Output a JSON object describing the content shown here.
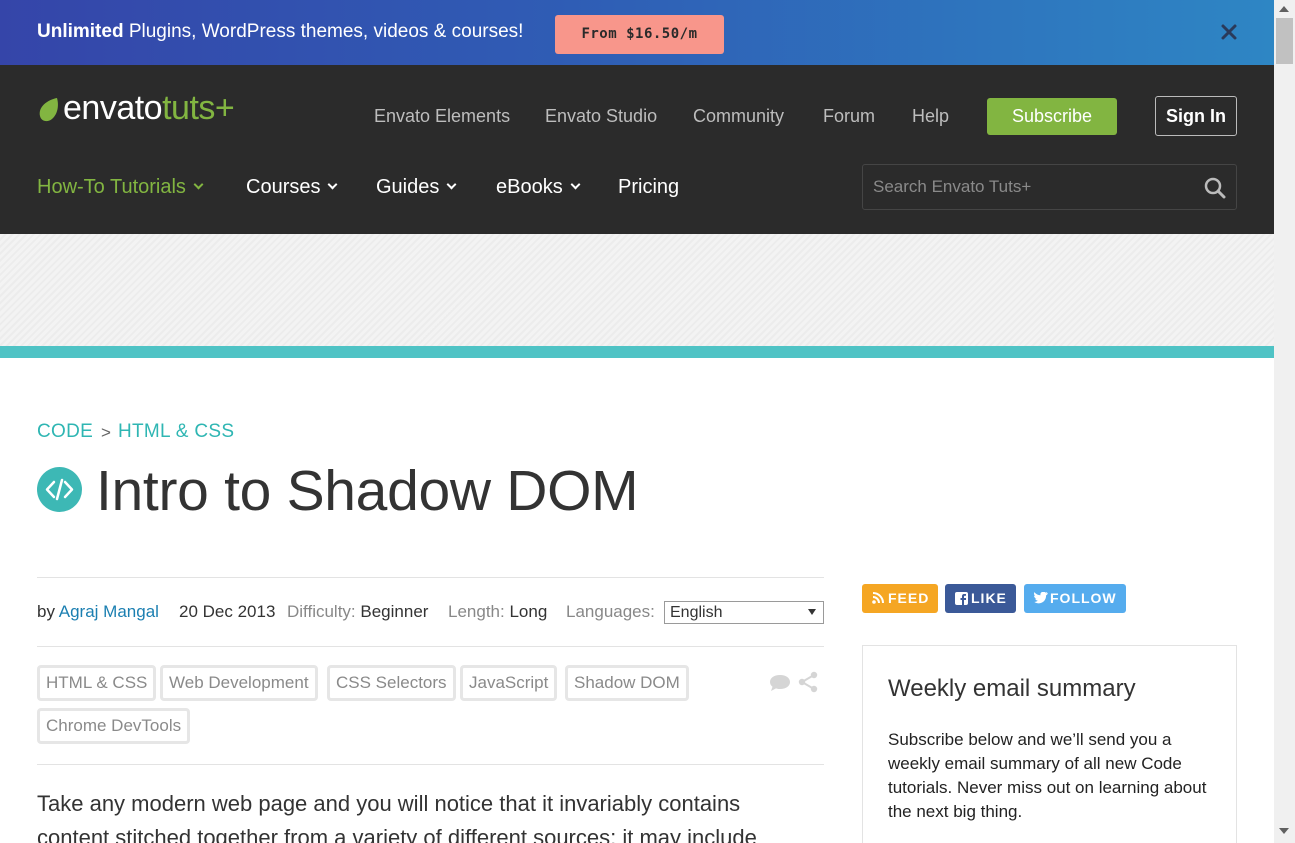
{
  "promo": {
    "bold": "Unlimited",
    "text": " Plugins, WordPress themes, videos & courses!",
    "button": "From $16.50/m"
  },
  "logo": {
    "word1": "envato",
    "word2": "tuts+"
  },
  "topnav": [
    "Envato Elements",
    "Envato Studio",
    "Community",
    "Forum",
    "Help"
  ],
  "auth": {
    "subscribe": "Subscribe",
    "signin": "Sign In"
  },
  "mainnav": [
    "How-To Tutorials",
    "Courses",
    "Guides",
    "eBooks",
    "Pricing"
  ],
  "search": {
    "placeholder": "Search Envato Tuts+"
  },
  "breadcrumb": {
    "category": "CODE",
    "separator": ">",
    "subcategory": "HTML & CSS"
  },
  "article": {
    "title": "Intro to Shadow DOM",
    "by": "by",
    "author": "Agraj Mangal",
    "date": "20 Dec 2013",
    "difficulty_label": "Difficulty:",
    "difficulty": "Beginner",
    "length_label": "Length:",
    "length": "Long",
    "languages_label": "Languages:",
    "language": "English",
    "tags": [
      "HTML & CSS",
      "Web Development",
      "CSS Selectors",
      "JavaScript",
      "Shadow DOM",
      "Chrome DevTools"
    ],
    "body_line1": "Take any modern web page and you will notice that it invariably contains",
    "body_line2": "content stitched together from a variety of different sources; it may include"
  },
  "social": {
    "feed": "FEED",
    "like": "LIKE",
    "follow": "FOLLOW"
  },
  "sidebar": {
    "email_title": "Weekly email summary",
    "email_text": "Subscribe below and we’ll send you a weekly email summary of all new Code tutorials. Never miss out on learning about the next big thing."
  },
  "colors": {
    "brand_green": "#82b541",
    "teal": "#4fc3c5",
    "feed": "#f5a623",
    "like": "#3b5998",
    "follow": "#55acee"
  }
}
